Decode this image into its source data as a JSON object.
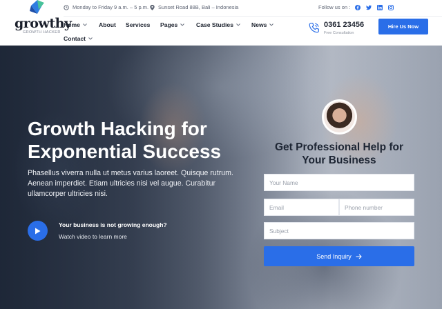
{
  "brand": {
    "name": "growthy",
    "tagline": "GROWTH HACKER"
  },
  "topbar": {
    "hours": "Monday to Friday 9 a.m. – 5 p.m.",
    "address": "Sunset Road 88B, Bali – Indonesia",
    "follow_label": "Follow us on :",
    "socials": [
      "facebook-icon",
      "twitter-icon",
      "linkedin-icon",
      "instagram-icon"
    ]
  },
  "nav": {
    "items": [
      {
        "label": "Home",
        "dropdown": true
      },
      {
        "label": "About",
        "dropdown": false
      },
      {
        "label": "Services",
        "dropdown": false
      },
      {
        "label": "Pages",
        "dropdown": true
      },
      {
        "label": "Case Studies",
        "dropdown": true
      },
      {
        "label": "News",
        "dropdown": true
      },
      {
        "label": "Contact",
        "dropdown": true
      }
    ]
  },
  "contact": {
    "phone": "0361 23456",
    "phone_caption": "Free Consultation"
  },
  "cta": {
    "hire_label": "Hire Us Now"
  },
  "hero": {
    "title": "Growth Hacking for Exponential Success",
    "description": "Phasellus viverra nulla ut metus varius laoreet. Quisque rutrum. Aenean imperdiet. Etiam ultricies nisi vel augue. Curabitur ullamcorper ultricies nisi.",
    "video_title": "Your business is not growing enough?",
    "video_subtitle": "Watch video to learn more"
  },
  "form": {
    "title": "Get Professional Help for Your Business",
    "name_placeholder": "Your Name",
    "email_placeholder": "Email",
    "phone_placeholder": "Phone number",
    "subject_placeholder": "Subject",
    "submit_label": "Send Inquiry"
  },
  "colors": {
    "accent": "#2a6ee8",
    "dark": "#1e2430"
  }
}
